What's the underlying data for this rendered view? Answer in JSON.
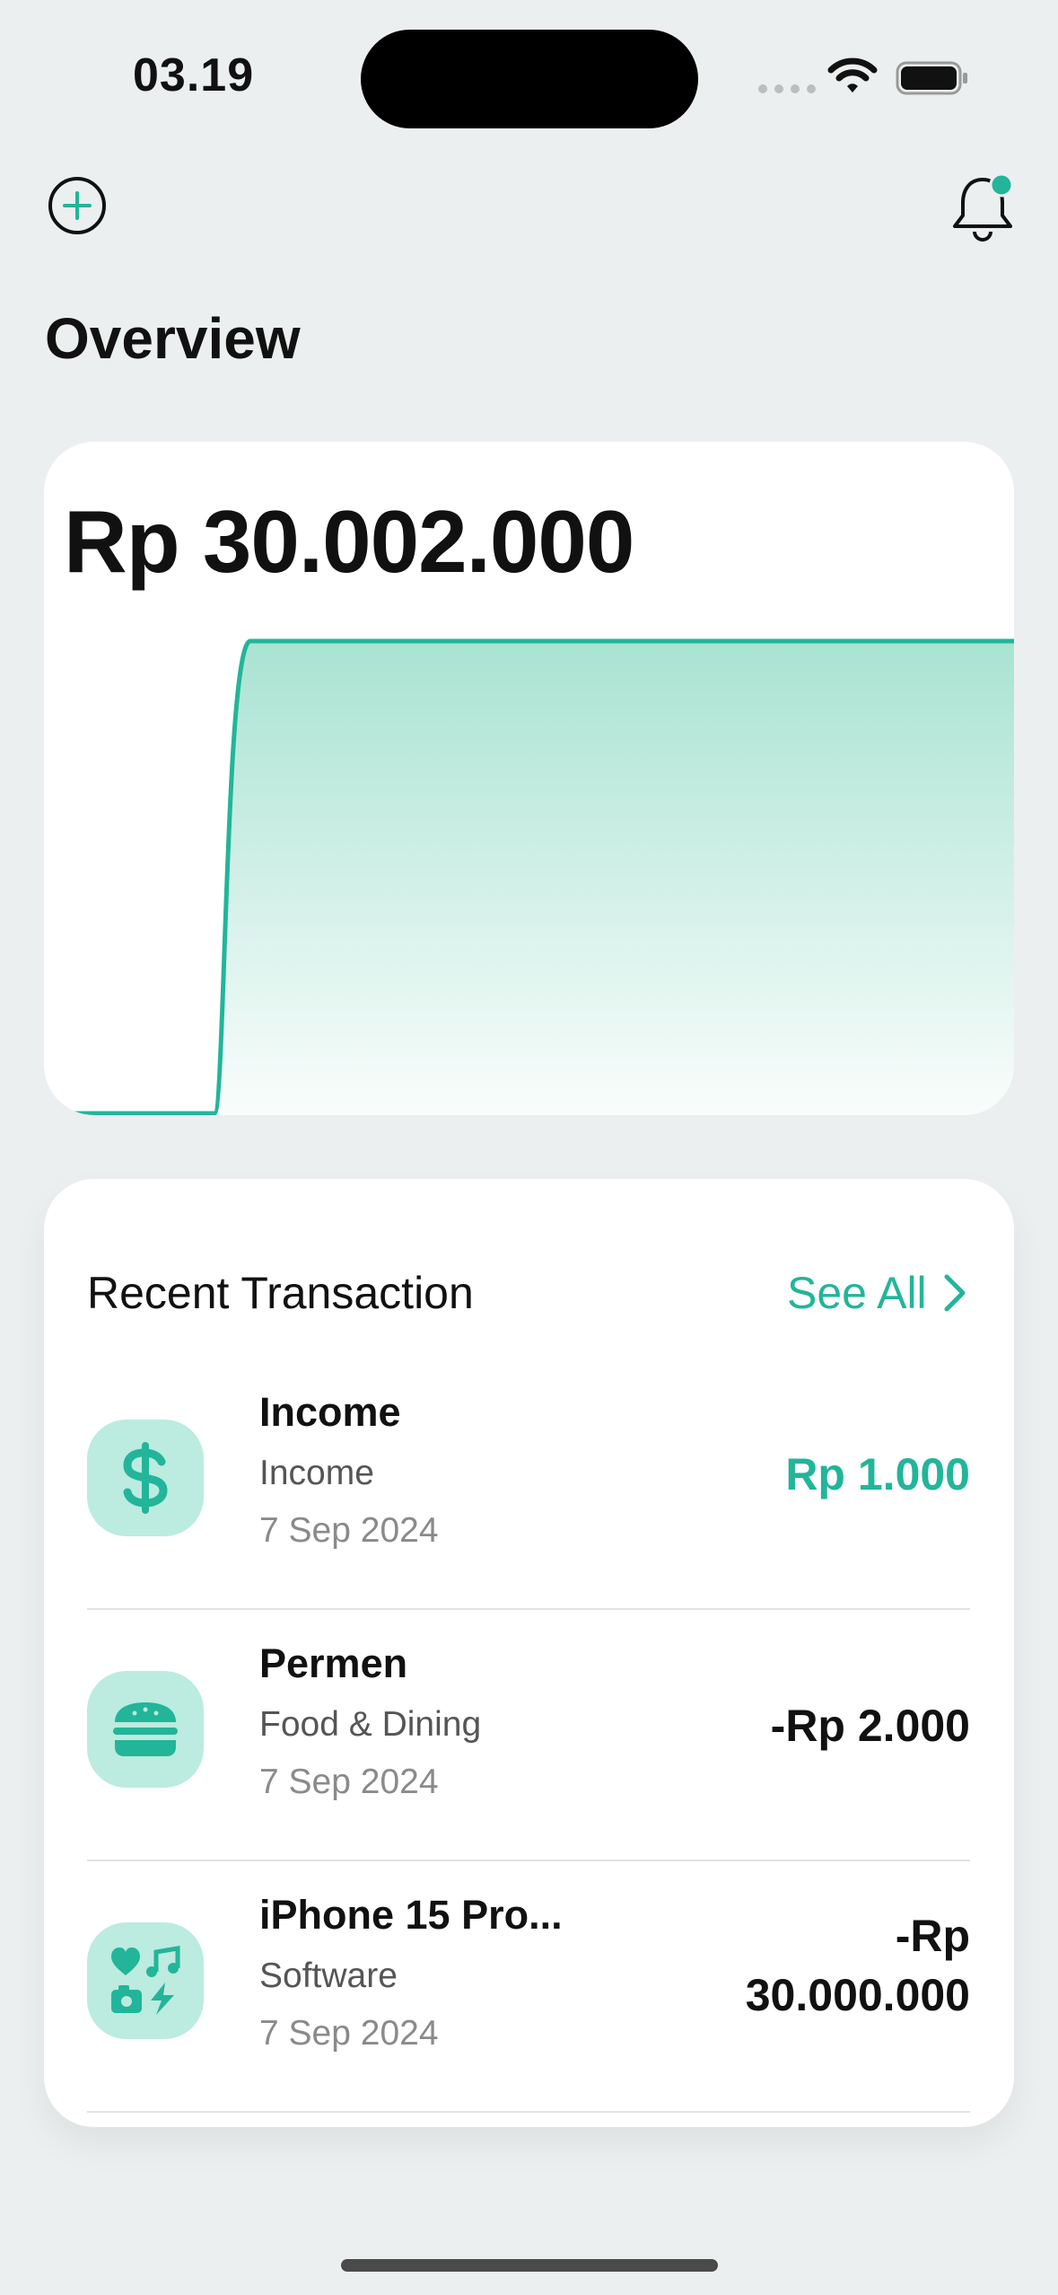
{
  "status_bar": {
    "time": "03.19",
    "wifi_icon": "wifi-icon",
    "battery_icon": "battery-icon"
  },
  "header": {
    "add_icon": "plus-circle-icon",
    "notification_icon": "bell-icon",
    "notification_badge_color": "#22B59A",
    "title": "Overview"
  },
  "balance": {
    "amount": "Rp 30.002.000"
  },
  "chart_data": {
    "type": "area",
    "series": [
      {
        "values": [
          0,
          0,
          30002000,
          30002000
        ]
      }
    ],
    "color": "#22B59A"
  },
  "recent": {
    "title": "Recent Transaction",
    "see_all": "See All",
    "items": [
      {
        "name": "Income",
        "category": "Income",
        "date": "7 Sep 2024",
        "amount": "Rp 1.000",
        "type": "income",
        "icon": "dollar-icon"
      },
      {
        "name": "Permen",
        "category": "Food & Dining",
        "date": "7 Sep 2024",
        "amount": "-Rp 2.000",
        "type": "expense",
        "icon": "burger-icon"
      },
      {
        "name": "iPhone 15 Pro...",
        "category": "Software",
        "date": "7 Sep 2024",
        "amount": "-Rp\n30.000.000",
        "type": "expense",
        "icon": "entertainment-icon"
      }
    ]
  },
  "accent_color": "#22B59A",
  "icon_bg_color": "#BCEBDF"
}
